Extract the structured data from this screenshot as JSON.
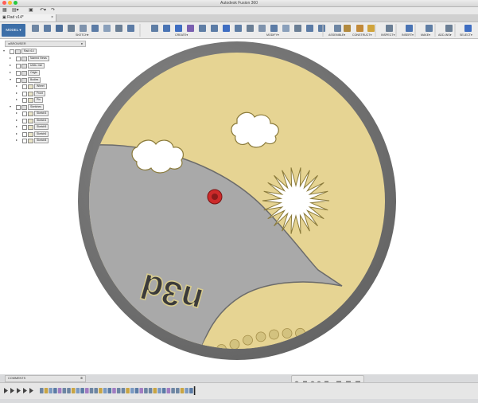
{
  "window": {
    "title": "Autodesk Fusion 360",
    "traffic_colors": [
      "#ff5f57",
      "#febc2e",
      "#28c840"
    ]
  },
  "quick_access": {
    "items": [
      "grid-icon",
      "save-icon",
      "undo-icon",
      "redo-icon"
    ]
  },
  "document_tab": {
    "name": "Rad v14*"
  },
  "ribbon": {
    "workspace_button": "MODEL",
    "groups": [
      "SKETCH",
      "CREATE",
      "MODIFY",
      "ASSEMBLE",
      "CONSTRUCT",
      "INSPECT",
      "INSERT",
      "MAKE",
      "ADD-INS",
      "SELECT"
    ],
    "accent_color": "#3d6fa8"
  },
  "browser": {
    "header": "BROWSER",
    "rows": [
      {
        "label": "Rad v14",
        "indent": 0,
        "expanded": true
      },
      {
        "label": "Named Views",
        "indent": 1,
        "expanded": false
      },
      {
        "label": "Units: mm",
        "indent": 1,
        "expanded": false
      },
      {
        "label": "Origin",
        "indent": 1,
        "expanded": false
      },
      {
        "label": "Bodies",
        "indent": 1,
        "expanded": true
      },
      {
        "label": "Wheel",
        "indent": 2,
        "expanded": false
      },
      {
        "label": "Front",
        "indent": 2,
        "expanded": false
      },
      {
        "label": "Pin",
        "indent": 2,
        "expanded": false
      },
      {
        "label": "Sketches",
        "indent": 1,
        "expanded": true
      },
      {
        "label": "Sketch3",
        "indent": 2,
        "expanded": false
      },
      {
        "label": "Sketch4",
        "indent": 2,
        "expanded": false
      },
      {
        "label": "Sketch5",
        "indent": 2,
        "expanded": false
      },
      {
        "label": "Sketch6",
        "indent": 2,
        "expanded": false
      },
      {
        "label": "Sketch8",
        "indent": 2,
        "expanded": false
      }
    ]
  },
  "comments": {
    "label": "COMMENTS"
  },
  "model": {
    "embossed_text": "n3d",
    "colors": {
      "rim": "#7d7d7d",
      "rim_dark": "#5b5b5b",
      "gold": "#e6d493",
      "gold_dark": "#b9a35a",
      "grey_face": "#a9a9a9",
      "pin": "#cc2a2a"
    }
  },
  "timeline": {
    "item_count": 34
  }
}
